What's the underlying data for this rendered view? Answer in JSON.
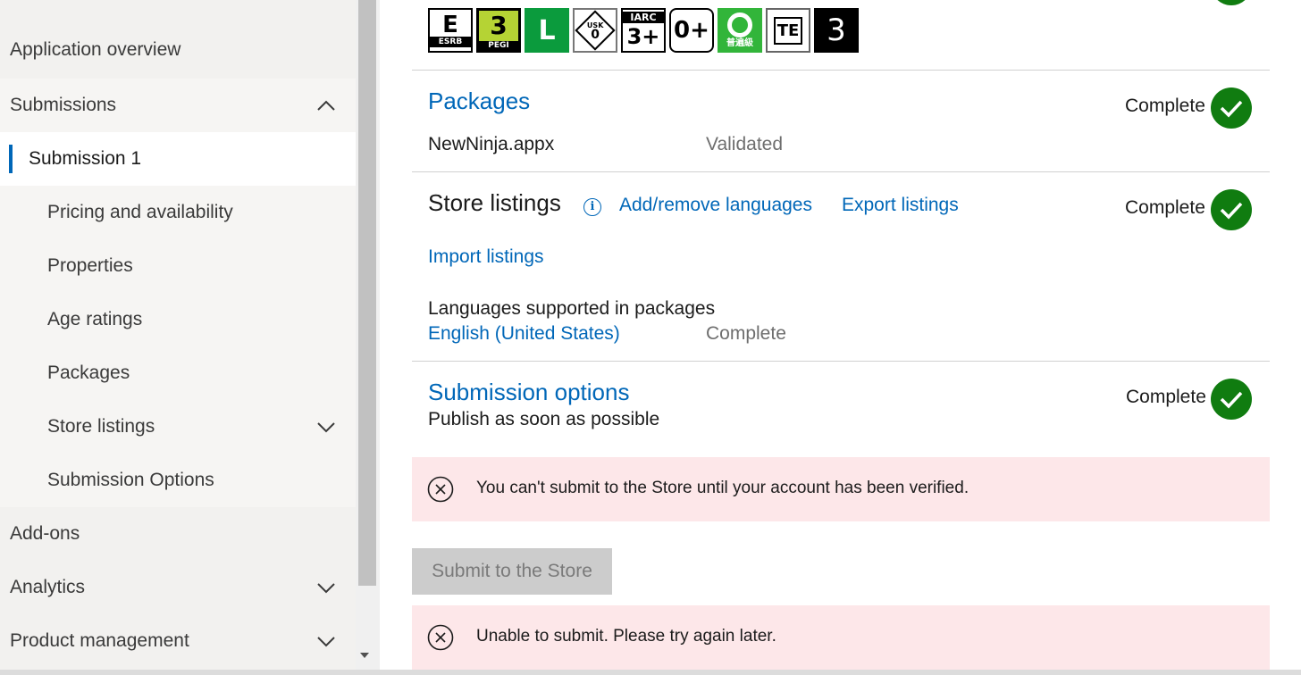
{
  "sidebar": {
    "items": [
      {
        "label": "Application overview"
      },
      {
        "label": "Submissions"
      },
      {
        "label": "Submission 1"
      },
      {
        "label": "Pricing and availability"
      },
      {
        "label": "Properties"
      },
      {
        "label": "Age ratings"
      },
      {
        "label": "Packages"
      },
      {
        "label": "Store listings"
      },
      {
        "label": "Submission Options"
      },
      {
        "label": "Add-ons"
      },
      {
        "label": "Analytics"
      },
      {
        "label": "Product management"
      }
    ]
  },
  "age_ratings": {
    "badges": [
      {
        "name": "ESRB E",
        "big": "E",
        "small": "ESRB"
      },
      {
        "name": "PEGI 3",
        "big": "3",
        "small": "PEGI"
      },
      {
        "name": "ClassInd L",
        "big": "L"
      },
      {
        "name": "USK 0",
        "top": "USK",
        "big": "0"
      },
      {
        "name": "IARC 3+",
        "small": "IARC",
        "big": "3+"
      },
      {
        "name": "0+",
        "big": "0+"
      },
      {
        "name": "GRAC general",
        "small": "普遍級"
      },
      {
        "name": "TE",
        "big": "TE"
      },
      {
        "name": "3",
        "big": "3"
      }
    ]
  },
  "packages": {
    "title": "Packages",
    "status": "Complete",
    "file_name": "NewNinja.appx",
    "file_status": "Validated"
  },
  "store_listings": {
    "title": "Store listings",
    "info_glyph": "i",
    "add_remove_link": "Add/remove languages",
    "export_link": "Export listings",
    "import_link": "Import listings",
    "status": "Complete",
    "languages_label": "Languages supported in packages",
    "language": "English (United States)",
    "language_status": "Complete"
  },
  "submission_options": {
    "title": "Submission options",
    "status": "Complete",
    "detail": "Publish as soon as possible"
  },
  "alerts": {
    "verify": "You can't submit to the Store until your account has been verified.",
    "unable": "Unable to submit. Please try again later."
  },
  "submit_button": {
    "label": "Submit to the Store"
  },
  "colors": {
    "accent": "#0067b8",
    "success": "#107c10",
    "error_bg": "#fde7e9"
  }
}
